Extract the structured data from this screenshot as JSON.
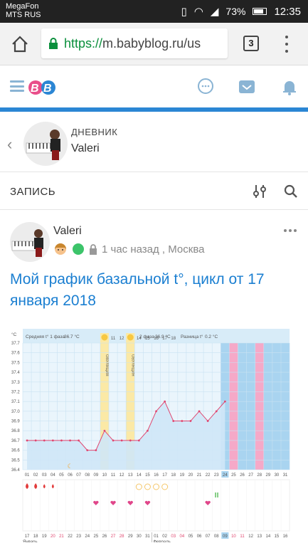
{
  "statusbar": {
    "carrier1": "MegaFon",
    "carrier2": "MTS RUS",
    "battery": "73%",
    "time": "12:35"
  },
  "browser": {
    "url_scheme": "https://",
    "url_rest": "m.babyblog.ru/us",
    "tab_count": "3"
  },
  "site": {
    "logo": "BB"
  },
  "diary": {
    "label": "ДНЕВНИК",
    "name": "Valeri"
  },
  "section": {
    "title": "ЗАПИСЬ"
  },
  "post": {
    "author": "Valeri",
    "time_location": "1 час назад , Москва",
    "title": "Мой график базальной t°, цикл от 17 января 2018"
  },
  "chart_data": {
    "type": "line",
    "unit_label": "°C",
    "phase1_label": "Средняя t° 1 фаза",
    "phase1_value": "36.7 °C",
    "phase2_label": "2 фаза",
    "phase2_value": "36.9 °C",
    "diff_label": "Разница t°",
    "diff_value": "0.2 °C",
    "ovulation_label": "ОВУЛЯЦИЯ",
    "ylim": [
      36.4,
      37.7
    ],
    "yticks": [
      "37.7",
      "37.6",
      "37.5",
      "37.4",
      "37.3",
      "37.2",
      "37.1",
      "37.0",
      "36.9",
      "36.8",
      "36.7",
      "36.6",
      "36.5",
      "36.4"
    ],
    "days": [
      "01",
      "02",
      "03",
      "04",
      "05",
      "06",
      "07",
      "08",
      "09",
      "10",
      "11",
      "12",
      "13",
      "14",
      "15",
      "16",
      "17",
      "18",
      "19",
      "20",
      "21",
      "22",
      "23",
      "24",
      "25",
      "26",
      "27",
      "28",
      "29",
      "30",
      "31"
    ],
    "top_days": [
      "01",
      "02",
      "03",
      "04",
      "05",
      "06",
      "07",
      "08",
      "09",
      "10",
      "11",
      "12",
      "13",
      "14",
      "15",
      "16",
      "17",
      "18"
    ],
    "values": [
      36.7,
      36.7,
      36.7,
      36.7,
      36.7,
      36.7,
      36.7,
      36.6,
      36.6,
      36.8,
      36.7,
      36.7,
      36.7,
      36.7,
      36.8,
      37.0,
      37.1,
      36.9,
      36.9,
      36.9,
      37.0,
      36.9,
      37.0,
      37.1
    ],
    "ovulation_days": [
      10,
      13
    ],
    "current_day": 24,
    "pink_days": [
      25,
      28
    ],
    "bleeding_days": [
      1,
      2,
      3,
      4
    ],
    "heart_days": [
      9,
      11,
      13,
      15,
      22
    ],
    "ring_days": [
      14,
      15,
      16,
      17
    ],
    "test_day": 23,
    "moon_day": 6,
    "dates": [
      "17",
      "18",
      "19",
      "20",
      "21",
      "22",
      "23",
      "24",
      "25",
      "26",
      "27",
      "28",
      "29",
      "30",
      "31",
      "01",
      "02",
      "03",
      "04",
      "05",
      "06",
      "07",
      "08",
      "09",
      "10",
      "11",
      "12",
      "13",
      "14",
      "15",
      "16"
    ],
    "month_jan": "Январь",
    "month_feb": "Февраль"
  }
}
